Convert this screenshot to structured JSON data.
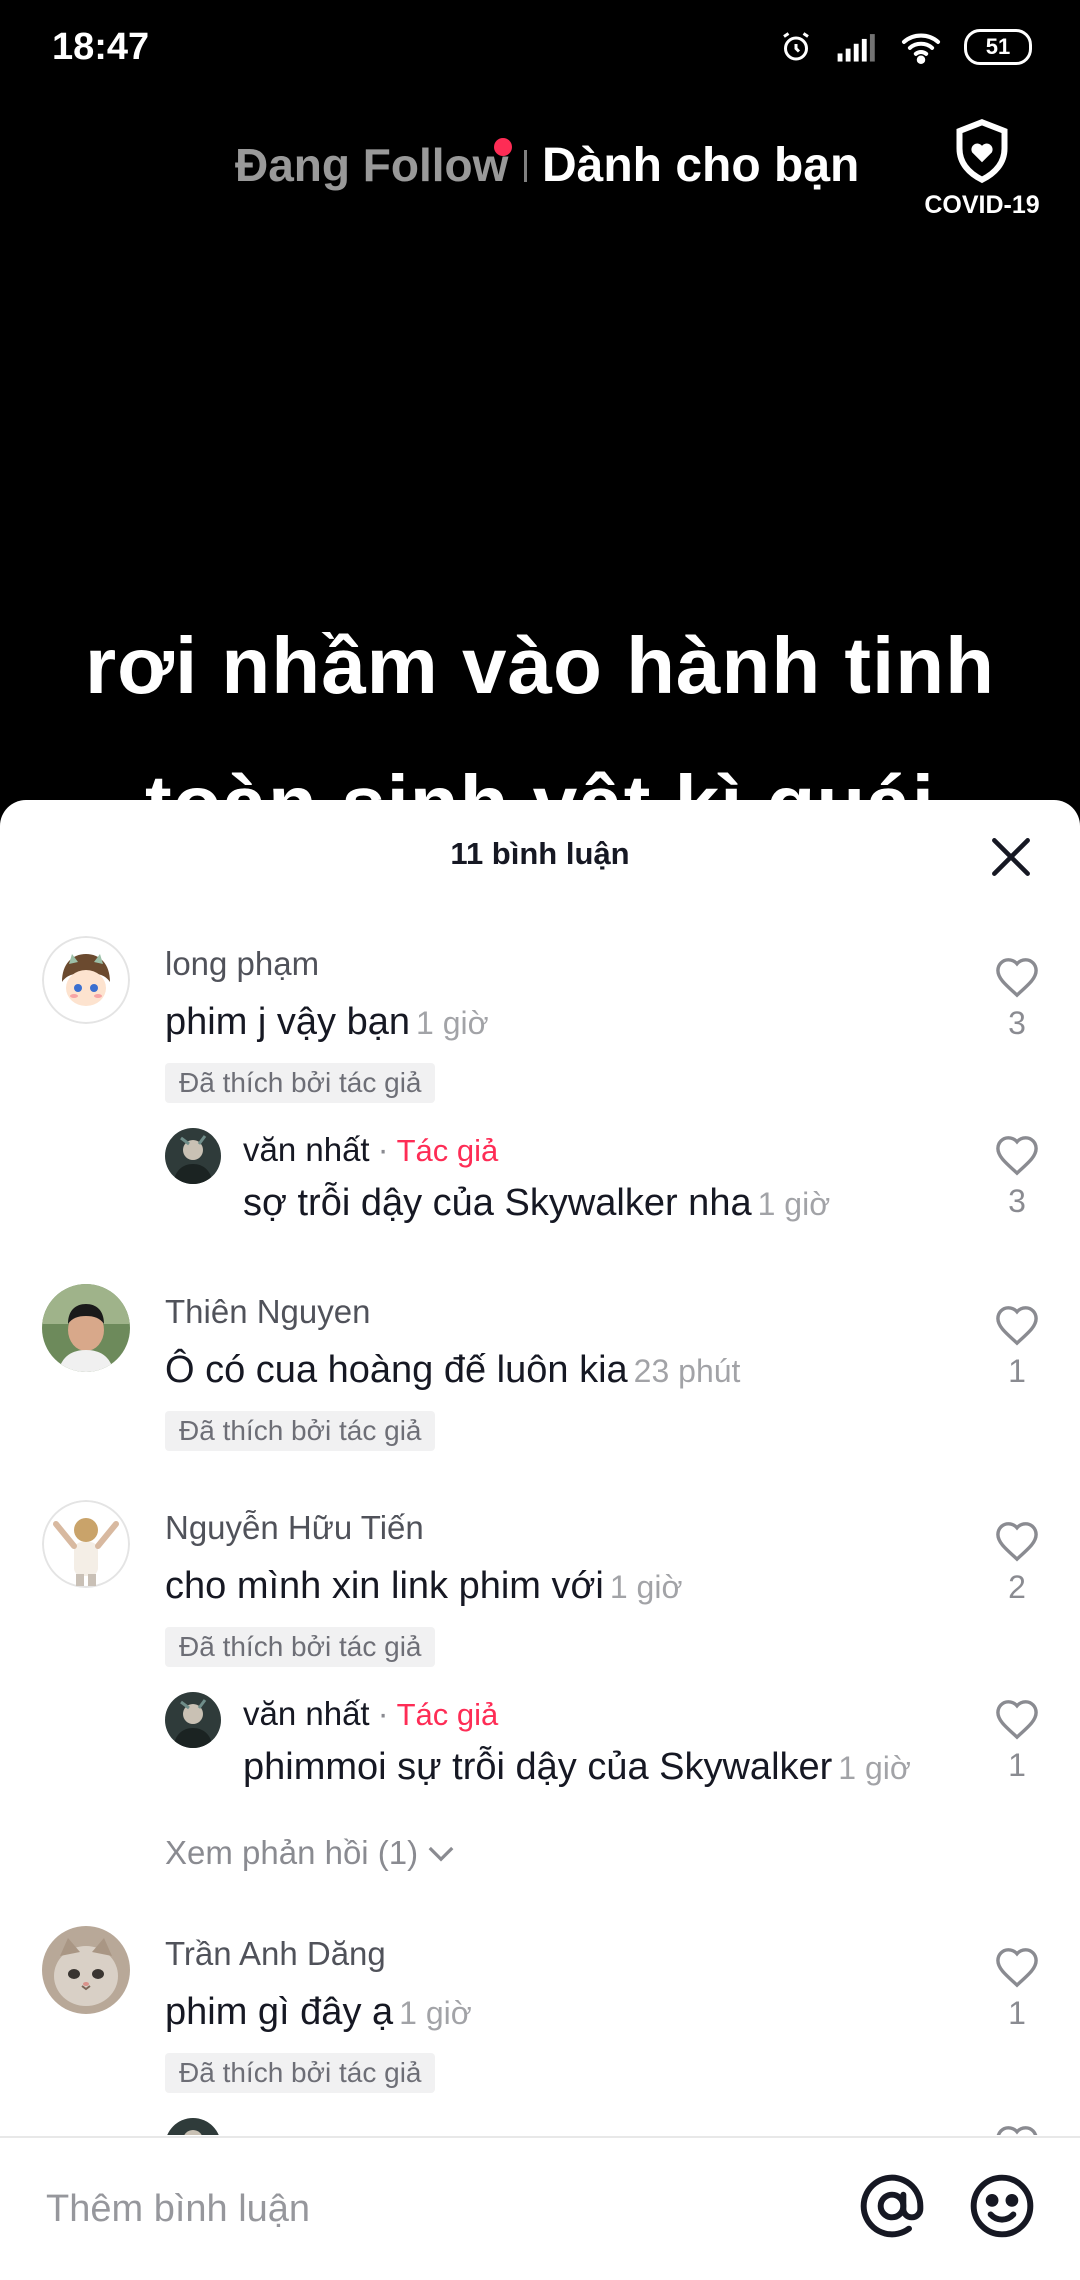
{
  "status": {
    "time": "18:47",
    "battery": "51"
  },
  "top_tabs": {
    "following": "Đang Follow",
    "for_you": "Dành cho bạn"
  },
  "covid": {
    "label": "COVID-19"
  },
  "video": {
    "caption_line1": "rơi nhầm vào hành tinh",
    "caption_line2": "toàn sinh vật kì quái"
  },
  "sheet": {
    "title": "11 bình luận"
  },
  "comments": [
    {
      "user": "long phạm",
      "text": "phim j vậy bạn",
      "time": "1 giờ",
      "badge": "Đã thích bởi tác giả",
      "likes": "3"
    },
    {
      "user": "văn nhất",
      "author_tag": "Tác giả",
      "text": "sợ trỗi dậy của Skywalker nha",
      "time": "1 giờ",
      "likes": "3"
    },
    {
      "user": "Thiên Nguyen",
      "text": "Ô có cua hoàng đế luôn kia",
      "time": "23 phút",
      "badge": "Đã thích bởi tác giả",
      "likes": "1"
    },
    {
      "user": "Nguyễn Hữu Tiến",
      "text": "cho mình xin link phim với",
      "time": "1 giờ",
      "badge": "Đã thích bởi tác giả",
      "likes": "2"
    },
    {
      "user": "văn nhất",
      "author_tag": "Tác giả",
      "text": "phimmoi sự trỗi dậy của Skywalker",
      "time": "1 giờ",
      "likes": "1"
    },
    {
      "user": "Trần Anh Dăng",
      "text": "phim gì đây ạ",
      "time": "1 giờ",
      "badge": "Đã thích bởi tác giả",
      "likes": "1"
    }
  ],
  "view_replies": "Xem phản hồi (1)",
  "input": {
    "placeholder": "Thêm bình luận"
  },
  "colors": {
    "accent": "#fe2c55",
    "text": "#161823",
    "muted": "#8a8b91"
  }
}
